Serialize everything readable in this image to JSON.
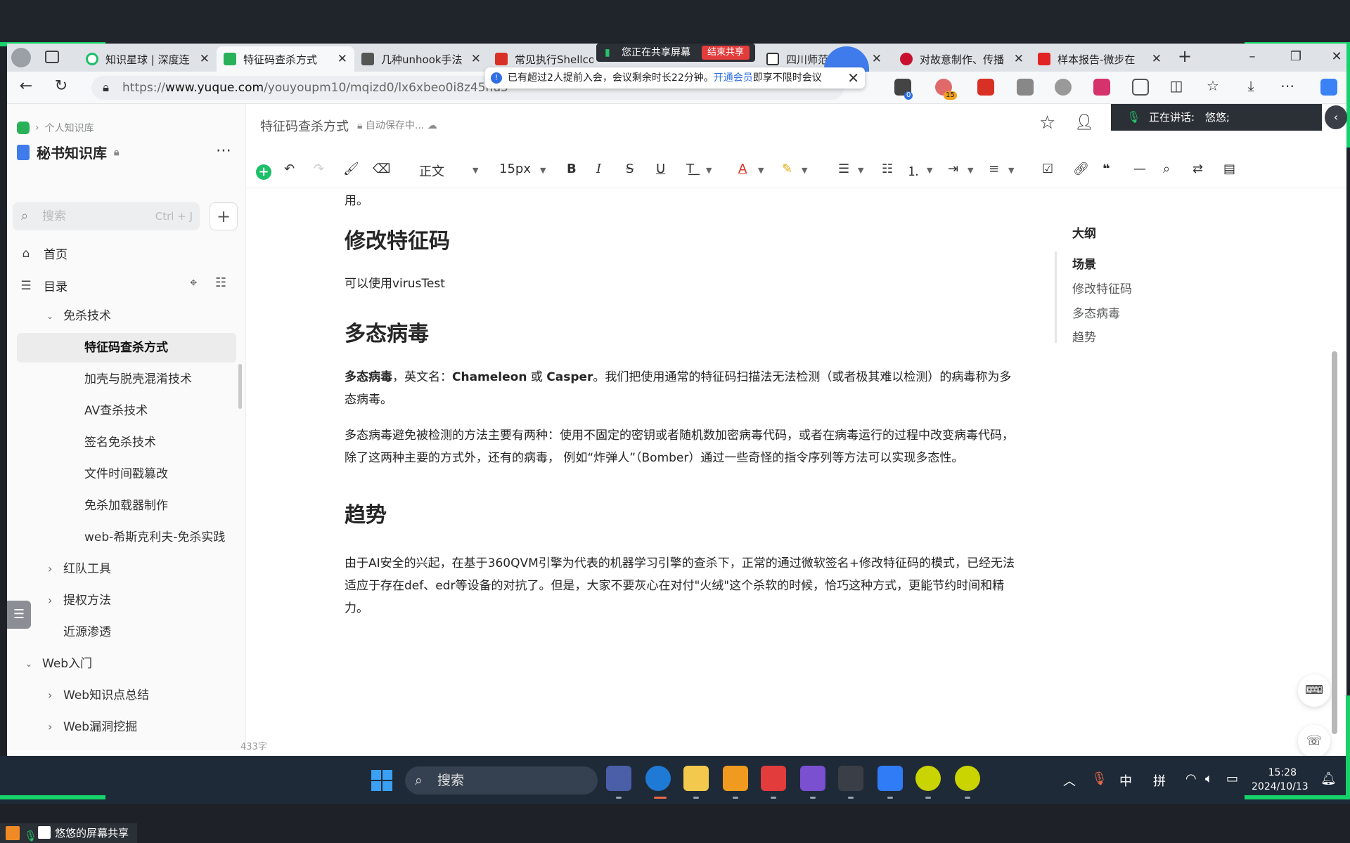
{
  "tabs": [
    {
      "title": "知识星球 | 深度连",
      "close": "✕"
    },
    {
      "title": "特征码查杀方式",
      "close": "✕"
    },
    {
      "title": "几种unhook手法",
      "close": "✕"
    },
    {
      "title": "常见执行Shellcod",
      "close": ""
    },
    {
      "title": "四川师范",
      "close": "✕"
    },
    {
      "title": "对故意制作、传播",
      "close": "✕"
    },
    {
      "title": "样本报告-微步在",
      "close": "✕"
    }
  ],
  "new_tab": "+",
  "url": {
    "prefix": "https://",
    "host": "www.yuque.com",
    "path": "/youyoupm10/mqizd0/lx6xbeo0i8z45hu5"
  },
  "share_bar": {
    "text": "您正在共享屏幕",
    "end_button": "结束共享"
  },
  "meeting_notice": {
    "text": "已有超过2人提前入会，会议剩余时长22分钟。",
    "link": "开通会员",
    "tail": "即享不限时会议",
    "close": "✕"
  },
  "speaking": {
    "label": "正在讲话:",
    "name": "悠悠;"
  },
  "ext_badges": {
    "badge1": "0",
    "badge2": "15"
  },
  "sidebar": {
    "breadcrumb": "个人知识库",
    "kb_title": "秘书知识库",
    "search_placeholder": "搜索",
    "search_shortcut": "Ctrl + J",
    "home": "首页",
    "toc": "目录",
    "tree": [
      {
        "label": "免杀技术",
        "chevron": "⌄"
      },
      {
        "label": "特征码查杀方式"
      },
      {
        "label": "加壳与脱壳混淆技术"
      },
      {
        "label": "AV查杀技术"
      },
      {
        "label": "签名免杀技术"
      },
      {
        "label": "文件时间戳篡改"
      },
      {
        "label": "免杀加载器制作"
      },
      {
        "label": "web-希斯克利夫-免杀实践"
      },
      {
        "label": "红队工具",
        "chevron": "›"
      },
      {
        "label": "提权方法",
        "chevron": "›"
      },
      {
        "label": "近源渗透"
      },
      {
        "label": "Web入门",
        "chevron": "⌄"
      },
      {
        "label": "Web知识点总结",
        "chevron": "›"
      },
      {
        "label": "Web漏洞挖掘",
        "chevron": "›"
      }
    ]
  },
  "doc": {
    "title": "特征码查杀方式",
    "autosave": "自动保存中...",
    "toolbar": {
      "para_style": "正文",
      "font_size": "15px"
    },
    "fragment_top": "用。",
    "h_modify": "修改特征码",
    "p_modify": "可以使用virusTest",
    "h_poly": "多态病毒",
    "p_poly1_bold": "多态病毒",
    "p_poly1_a": "，英文名：",
    "p_poly1_en1": "Chameleon",
    "p_poly1_or": " 或 ",
    "p_poly1_en2": "Casper",
    "p_poly1_b": "。我们把使用通常的特征码扫描法无法检测（或者极其难以检测）的病毒称为多态病毒。",
    "p_poly2": "多态病毒避免被检测的方法主要有两种：使用不固定的密钥或者随机数加密病毒代码，或者在病毒运行的过程中改变病毒代码，除了这两种主要的方式外，还有的病毒， 例如“炸弹人”（Bomber）通过一些奇怪的指令序列等方法可以实现多态性。",
    "h_trend": "趋势",
    "p_trend": "由于AI安全的兴起，在基于360QVM引擎为代表的机器学习引擎的查杀下，正常的通过微软签名+修改特征码的模式，已经无法适应于存在def、edr等设备的对抗了。但是，大家不要灰心在对付\"火绒\"这个杀软的时候，恰巧这种方式，更能节约时间和精力。",
    "word_count": "433字"
  },
  "outline": {
    "title": "大纲",
    "items": [
      "场景",
      "修改特征码",
      "多态病毒",
      "趋势"
    ]
  },
  "taskbar": {
    "search": "搜索",
    "ime1": "中",
    "ime2": "拼",
    "time": "15:28",
    "date": "2024/10/13"
  },
  "screen_share_label": "悠悠的屏幕共享",
  "colors": {
    "accent_green": "#15d36a",
    "yuque_green": "#29b159",
    "link_blue": "#2f6fe4"
  }
}
